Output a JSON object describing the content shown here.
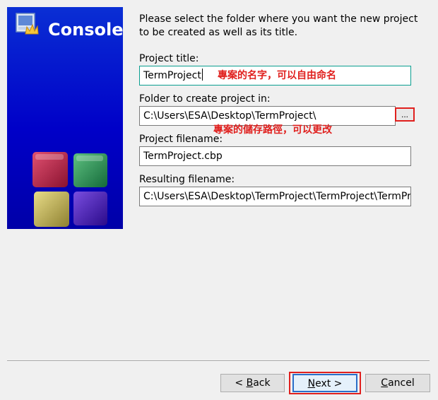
{
  "banner": {
    "title": "Console",
    "icon": "wizard-icon",
    "logo": "codeblocks-logo-icon"
  },
  "intro_text": "Please select the folder where you want the new project to be created as well as its title.",
  "fields": {
    "project_title": {
      "label": "Project title:",
      "value": "TermProject",
      "annotation": "專案的名字，可以自由命名"
    },
    "folder": {
      "label": "Folder to create project in:",
      "value": "C:\\Users\\ESA\\Desktop\\TermProject\\",
      "browse_label": "...",
      "annotation": "專案的儲存路徑，可以更改"
    },
    "project_filename": {
      "label": "Project filename:",
      "value": "TermProject.cbp"
    },
    "resulting_filename": {
      "label": "Resulting filename:",
      "value": "C:\\Users\\ESA\\Desktop\\TermProject\\TermProject\\TermProject.cbp"
    }
  },
  "buttons": {
    "back": {
      "prefix": "< ",
      "mnemonic": "B",
      "rest": "ack"
    },
    "next": {
      "mnemonic": "N",
      "rest": "ext >"
    },
    "cancel": {
      "mnemonic": "C",
      "rest": "ancel"
    }
  },
  "colors": {
    "banner_blue": "#0000c8",
    "annotation_red": "#e0201e",
    "focus_border": "#0a9e8f"
  }
}
